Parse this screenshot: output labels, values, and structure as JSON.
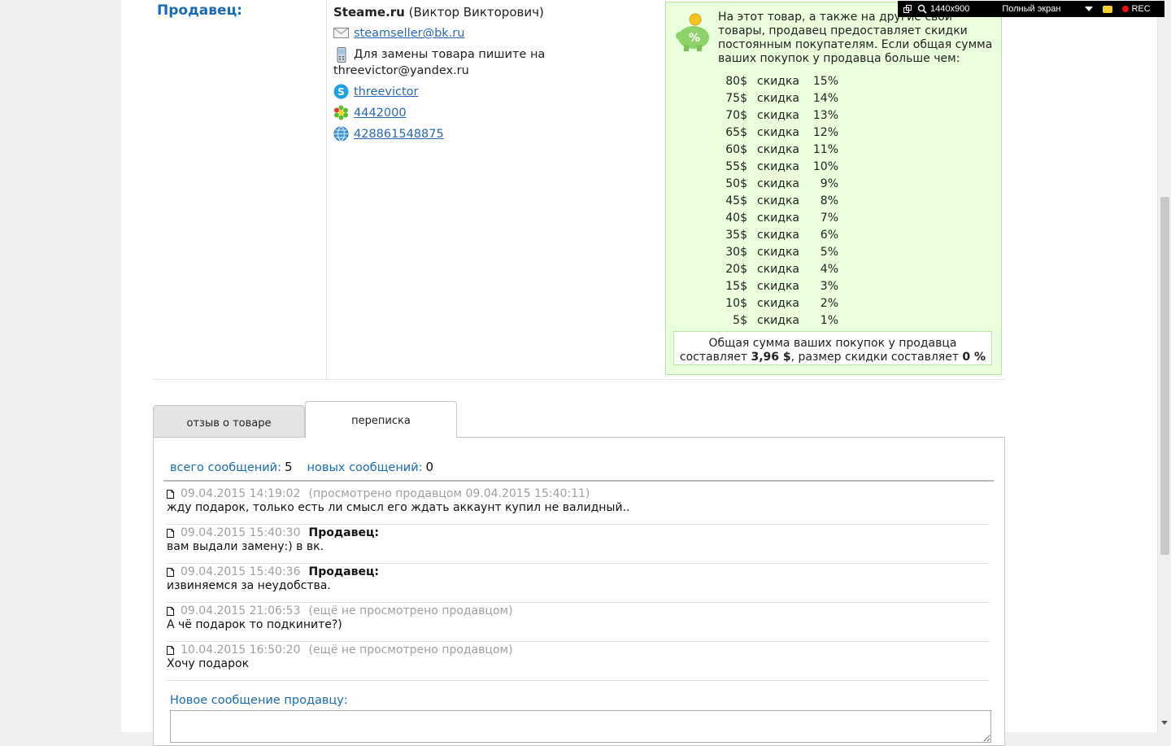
{
  "recorder": {
    "resolution": "1440x900",
    "mode": "Полный экран",
    "rec_label": "REC"
  },
  "seller": {
    "label": "Продавец:",
    "name_bold": "Steame.ru",
    "name_rest": " (Виктор Викторович)",
    "email": "steamseller@bk.ru",
    "replace_note": "Для замены товара пишите на threevictor@yandex.ru",
    "skype": "threevictor",
    "icq": "4442000",
    "webmoney": "428861548875"
  },
  "discount": {
    "intro": "На этот товар, а также на другие свои товары, продавец предоставляет скидки постоянным покупателям. Если общая сумма ваших покупок у продавца больше чем:",
    "rows": [
      {
        "amount": "80$",
        "label": "скидка",
        "percent": "15%"
      },
      {
        "amount": "75$",
        "label": "скидка",
        "percent": "14%"
      },
      {
        "amount": "70$",
        "label": "скидка",
        "percent": "13%"
      },
      {
        "amount": "65$",
        "label": "скидка",
        "percent": "12%"
      },
      {
        "amount": "60$",
        "label": "скидка",
        "percent": "11%"
      },
      {
        "amount": "55$",
        "label": "скидка",
        "percent": "10%"
      },
      {
        "amount": "50$",
        "label": "скидка",
        "percent": "9%"
      },
      {
        "amount": "45$",
        "label": "скидка",
        "percent": "8%"
      },
      {
        "amount": "40$",
        "label": "скидка",
        "percent": "7%"
      },
      {
        "amount": "35$",
        "label": "скидка",
        "percent": "6%"
      },
      {
        "amount": "30$",
        "label": "скидка",
        "percent": "5%"
      },
      {
        "amount": "20$",
        "label": "скидка",
        "percent": "4%"
      },
      {
        "amount": "15$",
        "label": "скидка",
        "percent": "3%"
      },
      {
        "amount": "10$",
        "label": "скидка",
        "percent": "2%"
      },
      {
        "amount": "5$",
        "label": "скидка",
        "percent": "1%"
      }
    ],
    "total_line1": "Общая сумма ваших покупок у продавца",
    "total_prefix": "составляет ",
    "total_amount": "3,96 $",
    "total_middle": ", размер скидки составляет ",
    "total_discount": "0 %"
  },
  "tabs": [
    {
      "label": "отзыв о товаре"
    },
    {
      "label": "переписка"
    }
  ],
  "counts": {
    "total_label": "всего сообщений:",
    "total_value": "5",
    "new_label": "новых сообщений:",
    "new_value": "0"
  },
  "messages": [
    {
      "date": "09.04.2015 14:19:02",
      "author": "",
      "status": "(просмотрено продавцом 09.04.2015 15:40:11)",
      "text": "жду подарок, только есть ли смысл его ждать аккаунт купил не валидный.."
    },
    {
      "date": "09.04.2015 15:40:30",
      "author": "Продавец:",
      "status": "",
      "text": "вам выдали замену:) в вк."
    },
    {
      "date": "09.04.2015 15:40:36",
      "author": "Продавец:",
      "status": "",
      "text": "извиняемся за неудобства."
    },
    {
      "date": "09.04.2015 21:06:53",
      "author": "",
      "status": "(ещё не просмотрено продавцом)",
      "text": "А чё подарок то подкините?)"
    },
    {
      "date": "10.04.2015 16:50:20",
      "author": "",
      "status": "(ещё не просмотрено продавцом)",
      "text": "Хочу подарок"
    }
  ],
  "new_message": {
    "label": "Новое сообщение продавцу:",
    "value": ""
  }
}
